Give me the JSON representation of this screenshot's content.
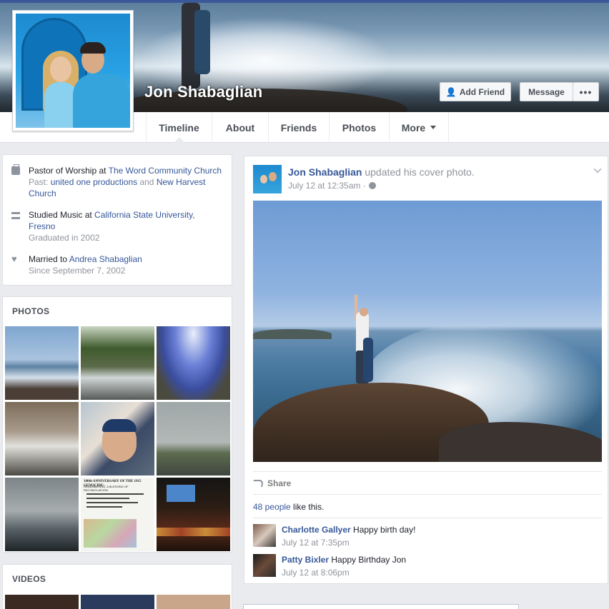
{
  "profile": {
    "name": "Jon Shabaglian",
    "buttons": {
      "add_friend": "Add Friend",
      "message": "Message",
      "more": "•••"
    }
  },
  "nav": {
    "tabs": [
      {
        "label": "Timeline"
      },
      {
        "label": "About"
      },
      {
        "label": "Friends"
      },
      {
        "label": "Photos"
      },
      {
        "label": "More"
      }
    ]
  },
  "intro": {
    "work": {
      "prefix": "Pastor of Worship at ",
      "employer": "The Word Community Church",
      "past_label": "Past: ",
      "past1": "united one productions",
      "and": " and ",
      "past2": "New Harvest Church"
    },
    "education": {
      "prefix": "Studied Music at ",
      "school": "California State University, Fresno",
      "graduated": "Graduated in 2002"
    },
    "relationship": {
      "prefix": "Married to ",
      "partner": "Andrea Shabaglian",
      "since": "Since September 7, 2002"
    }
  },
  "photos": {
    "title": "PHOTOS"
  },
  "videos": {
    "title": "VIDEOS"
  },
  "post": {
    "author": "Jon Shabaglian",
    "action": " updated his cover photo.",
    "time": "July 12 at 12:35am ·",
    "share_label": "Share",
    "likes_count": "48 people",
    "likes_suffix": " like this.",
    "comments": [
      {
        "author": "Charlotte Gallyer",
        "text": " Happy birth day!",
        "time": "July 12 at 7:35pm"
      },
      {
        "author": "Patty Bixler",
        "text": " Happy Birthday Jon",
        "time": "July 12 at 8:06pm"
      }
    ]
  },
  "photo_thumb_text": {
    "title": "100th ANNIVERSARY OF THE 1915 GENOCIDE:",
    "subtitle": "REMEMBERING, A BLESSING OF RECONCILIATION"
  },
  "colors": {
    "brand": "#3b5998",
    "link": "#365899",
    "muted": "#90949c"
  }
}
